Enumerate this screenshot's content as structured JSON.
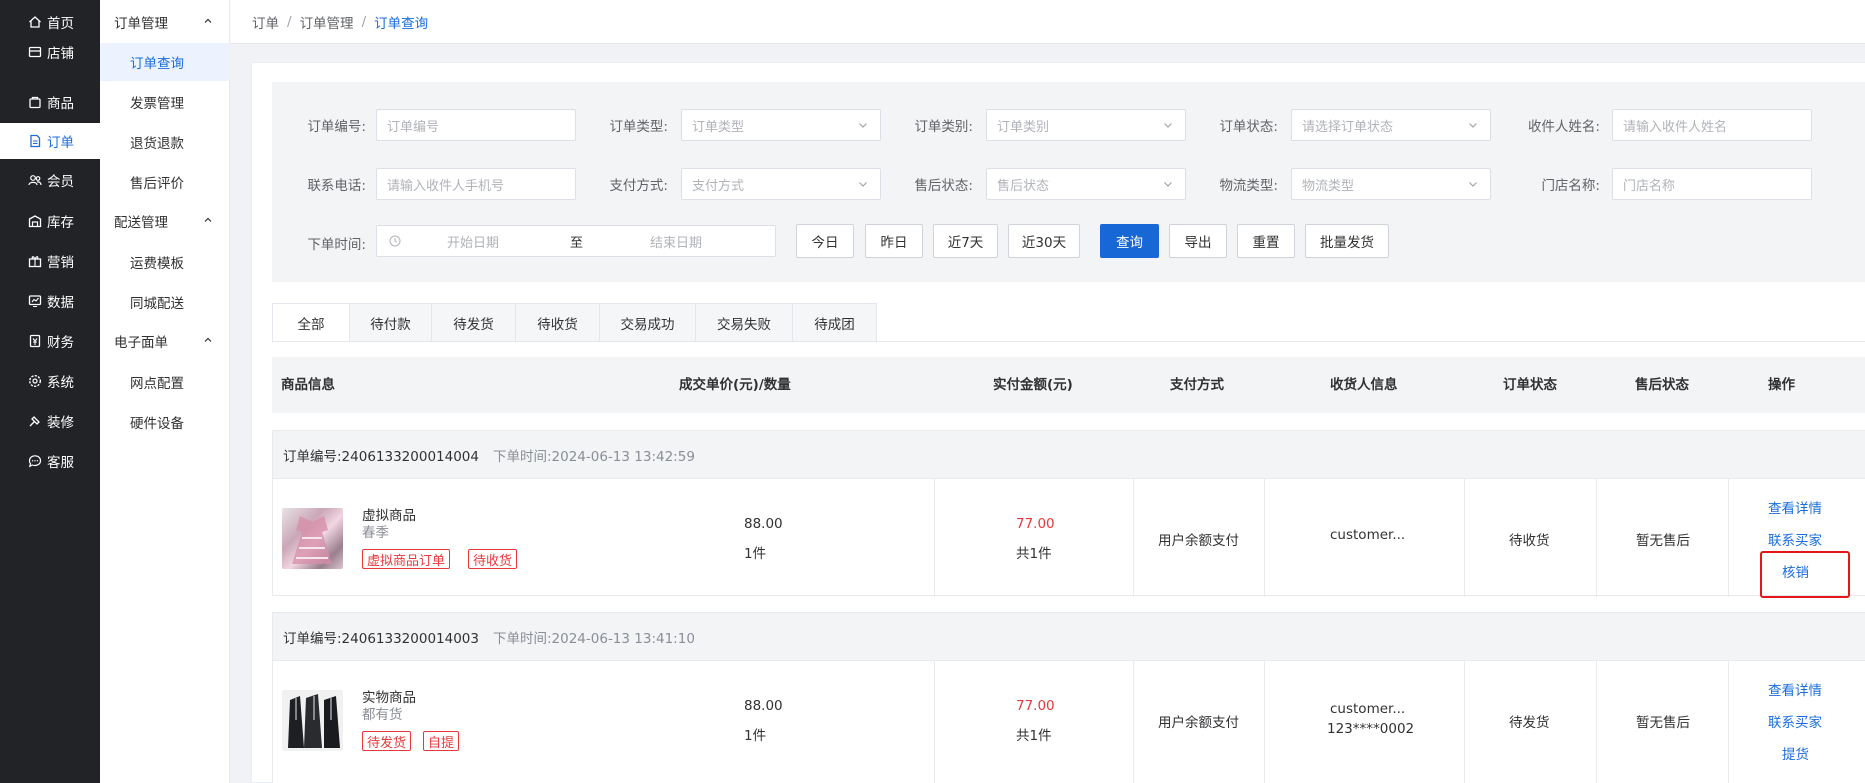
{
  "left_nav": [
    {
      "label": "首页",
      "icon": "home-icon"
    },
    {
      "label": "店铺",
      "icon": "shop-icon"
    },
    {
      "label": "商品",
      "icon": "goods-icon"
    },
    {
      "label": "订单",
      "icon": "order-icon",
      "active": true
    },
    {
      "label": "会员",
      "icon": "member-icon"
    },
    {
      "label": "库存",
      "icon": "inventory-icon"
    },
    {
      "label": "营销",
      "icon": "marketing-icon"
    },
    {
      "label": "数据",
      "icon": "data-icon"
    },
    {
      "label": "财务",
      "icon": "finance-icon"
    },
    {
      "label": "系统",
      "icon": "system-icon"
    },
    {
      "label": "装修",
      "icon": "decorate-icon"
    },
    {
      "label": "客服",
      "icon": "service-icon"
    }
  ],
  "sub_nav": {
    "groups": [
      {
        "label": "订单管理",
        "items": [
          "订单查询",
          "发票管理",
          "退货退款",
          "售后评价"
        ]
      },
      {
        "label": "配送管理",
        "items": [
          "运费模板",
          "同城配送"
        ]
      },
      {
        "label": "电子面单",
        "items": [
          "网点配置",
          "硬件设备"
        ]
      }
    ],
    "active_item": "订单查询"
  },
  "breadcrumb": {
    "items": [
      "订单",
      "订单管理",
      "订单查询"
    ],
    "separator": "/"
  },
  "filters": {
    "order_no": {
      "label": "订单编号:",
      "placeholder": "订单编号"
    },
    "order_type": {
      "label": "订单类型:",
      "placeholder": "订单类型"
    },
    "order_category": {
      "label": "订单类别:",
      "placeholder": "订单类别"
    },
    "order_status": {
      "label": "订单状态:",
      "placeholder": "请选择订单状态"
    },
    "receiver_name": {
      "label": "收件人姓名:",
      "placeholder": "请输入收件人姓名"
    },
    "phone": {
      "label": "联系电话:",
      "placeholder": "请输入收件人手机号"
    },
    "pay_method": {
      "label": "支付方式:",
      "placeholder": "支付方式"
    },
    "after_sale": {
      "label": "售后状态:",
      "placeholder": "售后状态"
    },
    "logistics": {
      "label": "物流类型:",
      "placeholder": "物流类型"
    },
    "store_name": {
      "label": "门店名称:",
      "placeholder": "门店名称"
    },
    "order_time": {
      "label": "下单时间:",
      "start": "开始日期",
      "to": "至",
      "end": "结束日期"
    },
    "buttons": {
      "today": "今日",
      "yesterday": "昨日",
      "last7": "近7天",
      "last30": "近30天",
      "query": "查询",
      "export": "导出",
      "reset": "重置",
      "batch_ship": "批量发货"
    }
  },
  "tabs": [
    "全部",
    "待付款",
    "待发货",
    "待收货",
    "交易成功",
    "交易失败",
    "待成团"
  ],
  "table_headers": {
    "goods": "商品信息",
    "price_qty": "成交单价(元)/数量",
    "paid": "实付金额(元)",
    "pay_method": "支付方式",
    "receiver": "收货人信息",
    "order_status": "订单状态",
    "after_sale": "售后状态",
    "ops": "操作"
  },
  "orders": [
    {
      "order_no": "订单编号:2406133200014004",
      "order_time": "下单时间:2024-06-13 13:42:59",
      "goods_name": "虚拟商品",
      "goods_spec": "春季",
      "tags": [
        "虚拟商品订单",
        "待收货"
      ],
      "price": "88.00",
      "qty": "1件",
      "paid": "77.00",
      "paid_count": "共1件",
      "pay_method": "用户余额支付",
      "receiver_name": "customer...",
      "receiver_phone": "",
      "status": "待收货",
      "after_sale": "暂无售后",
      "actions": [
        "查看详情",
        "联系买家",
        "核销"
      ]
    },
    {
      "order_no": "订单编号:2406133200014003",
      "order_time": "下单时间:2024-06-13 13:41:10",
      "goods_name": "实物商品",
      "goods_spec": "都有货",
      "tags": [
        "待发货",
        "自提"
      ],
      "price": "88.00",
      "qty": "1件",
      "paid": "77.00",
      "paid_count": "共1件",
      "pay_method": "用户余额支付",
      "receiver_name": "customer...",
      "receiver_phone": "123****0002",
      "status": "待发货",
      "after_sale": "暂无售后",
      "actions": [
        "查看详情",
        "联系买家",
        "提货"
      ]
    }
  ],
  "colors": {
    "accent": "#1a6ddc",
    "primary_button": "#1767d6",
    "danger": "#e8393a",
    "highlight_box": "#e5161a",
    "nav_bg": "#222326"
  }
}
